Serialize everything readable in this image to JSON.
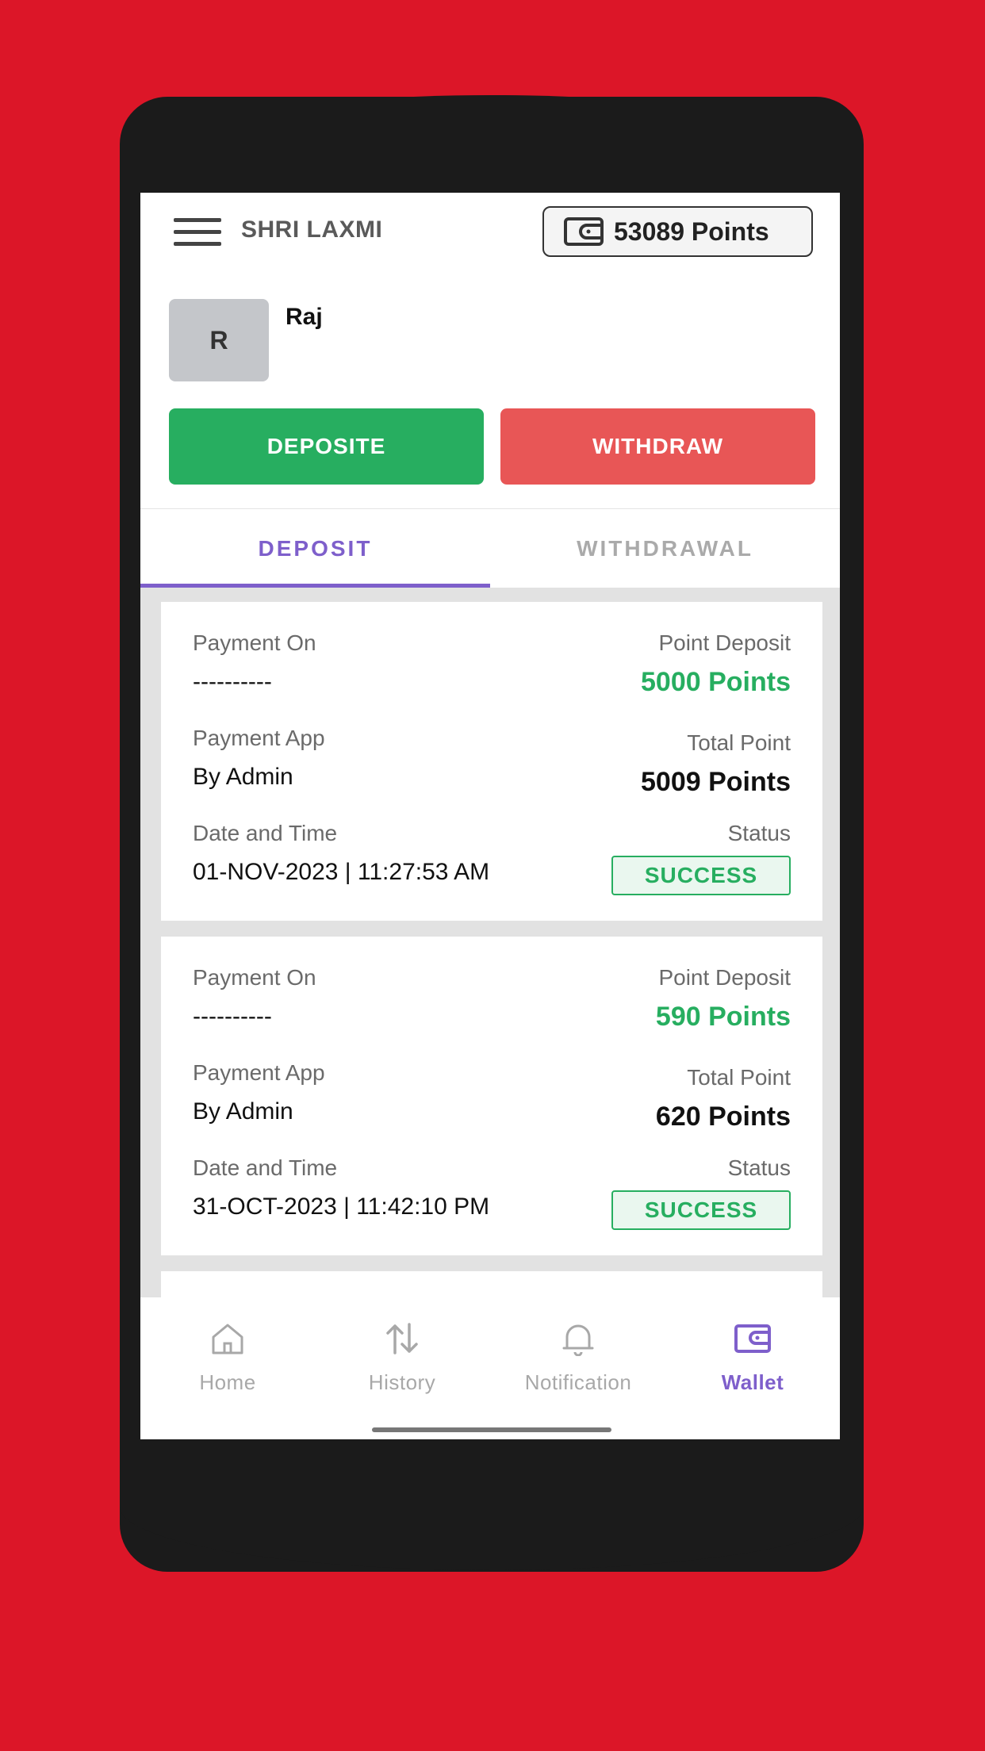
{
  "header": {
    "brand": "SHRI LAXMI",
    "points_label": "53089 Points"
  },
  "user": {
    "initial": "R",
    "name": "Raj"
  },
  "actions": {
    "deposit_label": "DEPOSITE",
    "withdraw_label": "WITHDRAW"
  },
  "tabs": [
    {
      "label": "DEPOSIT",
      "active": true
    },
    {
      "label": "WITHDRAWAL",
      "active": false
    }
  ],
  "labels": {
    "payment_on": "Payment On",
    "point_deposit": "Point Deposit",
    "payment_app": "Payment App",
    "total_point": "Total Point",
    "date_time": "Date and Time",
    "status": "Status"
  },
  "transactions": [
    {
      "payment_on": "----------",
      "point_deposit": "5000 Points",
      "payment_app": "By Admin",
      "total_point": "5009 Points",
      "date_time": "01-NOV-2023 | 11:27:53 AM",
      "status": "SUCCESS"
    },
    {
      "payment_on": "----------",
      "point_deposit": "590 Points",
      "payment_app": "By Admin",
      "total_point": "620 Points",
      "date_time": "31-OCT-2023 | 11:42:10 PM",
      "status": "SUCCESS"
    }
  ],
  "bottom_nav": [
    {
      "label": "Home",
      "icon": "home-icon",
      "active": false
    },
    {
      "label": "History",
      "icon": "history-icon",
      "active": false
    },
    {
      "label": "Notification",
      "icon": "bell-icon",
      "active": false
    },
    {
      "label": "Wallet",
      "icon": "wallet-icon",
      "active": true
    }
  ],
  "colors": {
    "background": "#dc1628",
    "accent": "#7e5fcb",
    "success": "#27ae60",
    "withdraw": "#e85656"
  }
}
